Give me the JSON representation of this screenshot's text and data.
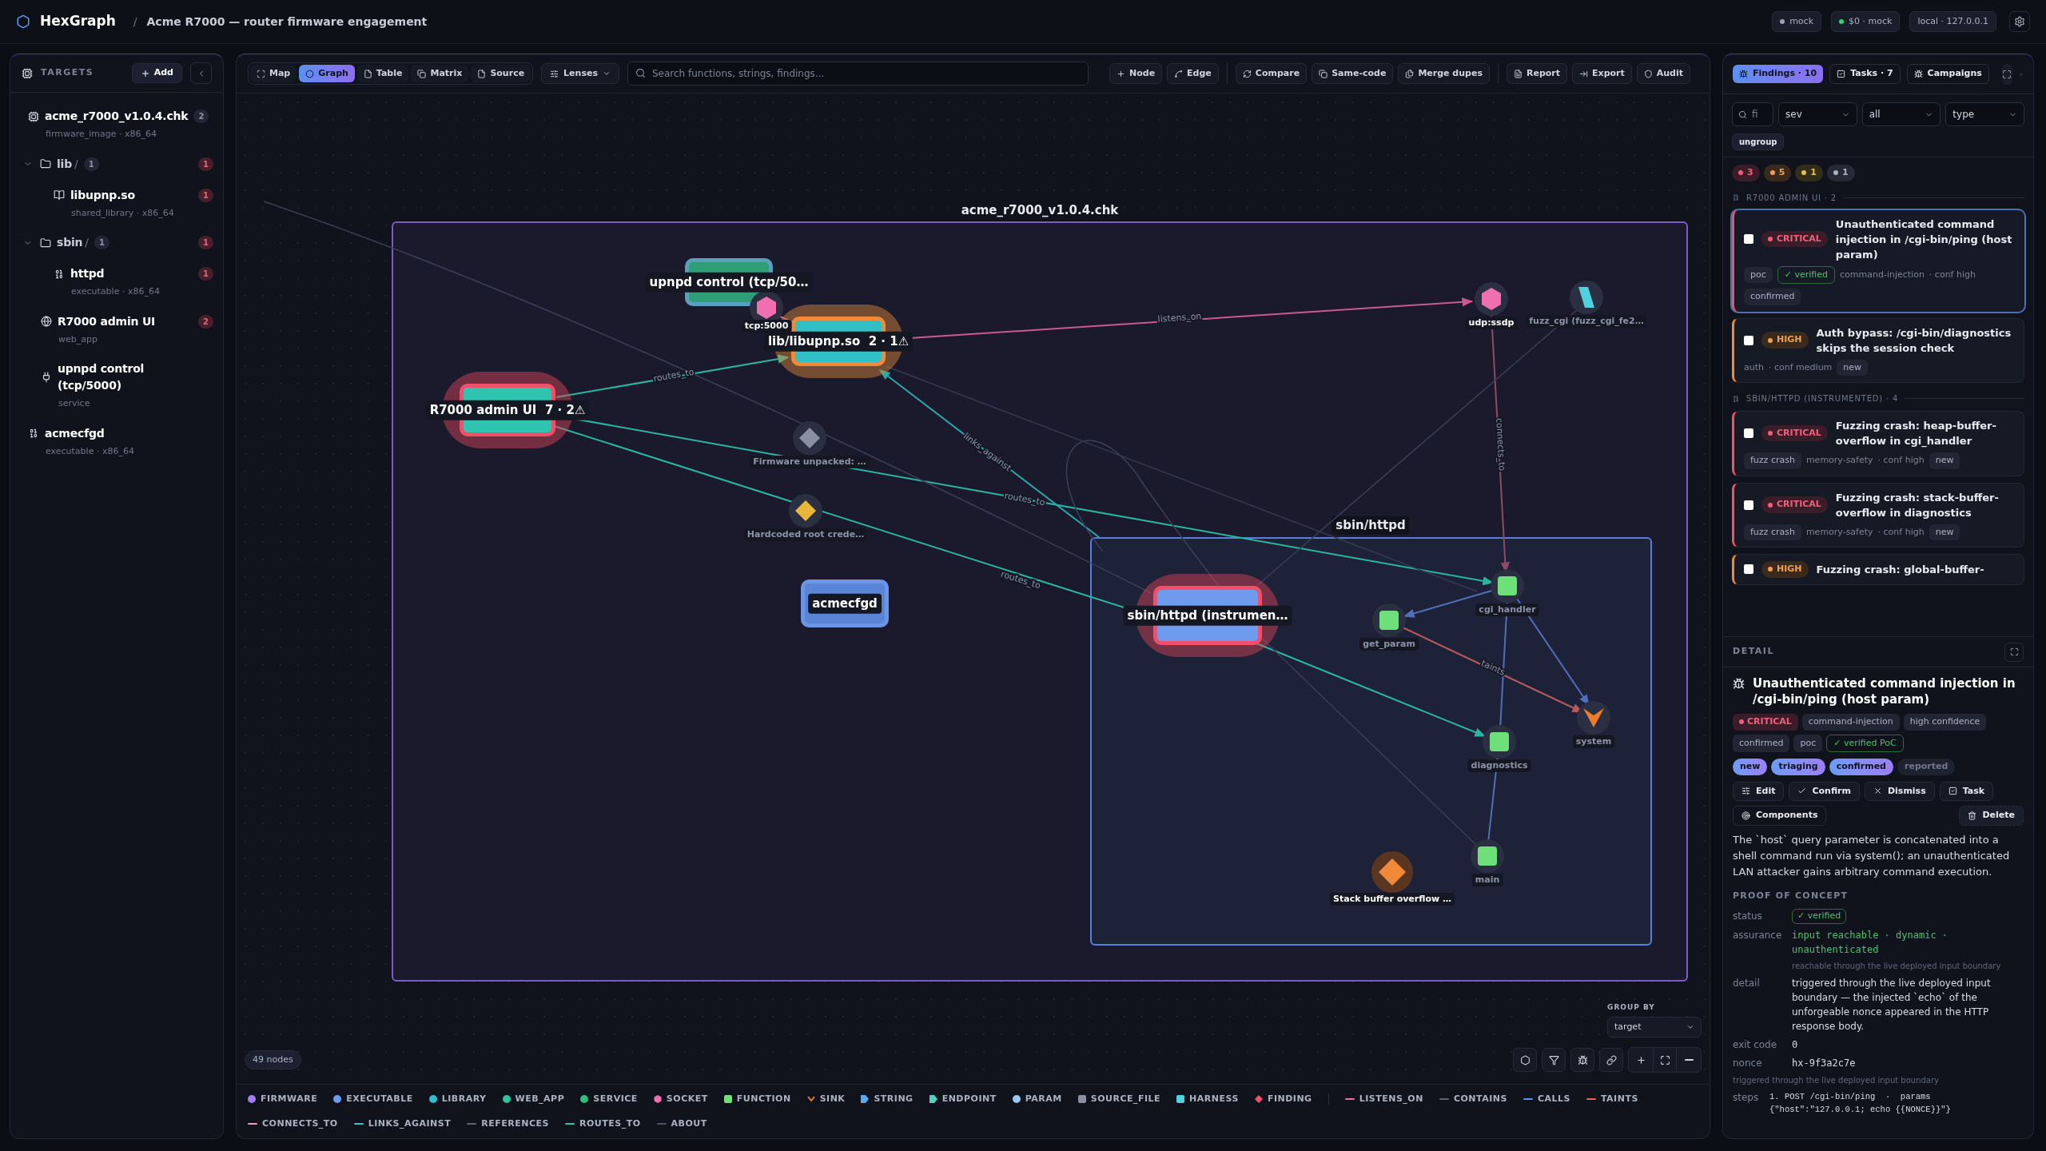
{
  "app": {
    "name": "HexGraph",
    "separator": "/",
    "engagement": "Acme R7000 — router firmware engagement",
    "status_chips": [
      {
        "label": "mock",
        "color": "#9aa3b5"
      },
      {
        "label": "$0 · mock",
        "color": "#3ecf6e"
      },
      {
        "label": "local · 127.0.0.1"
      }
    ]
  },
  "sidebar": {
    "title": "TARGETS",
    "add_button": "Add",
    "targets": [
      {
        "kind": "firmware",
        "name": "acme_r7000_v1.0.4.chk",
        "count": "2",
        "sub": "firmware_image · x86_64",
        "children": [
          {
            "kind": "folder",
            "name": "lib",
            "suffix": "/",
            "count": "1",
            "findings": "1",
            "expanded": true,
            "children": [
              {
                "kind": "library",
                "name": "libupnp.so",
                "sub": "shared_library · x86_64",
                "findings": "1"
              }
            ]
          },
          {
            "kind": "folder",
            "name": "sbin",
            "suffix": "/",
            "count": "1",
            "findings": "1",
            "expanded": true,
            "children": [
              {
                "kind": "executable",
                "name": "httpd",
                "sub": "executable · x86_64",
                "findings": "1"
              }
            ]
          },
          {
            "kind": "web",
            "name": "R7000 admin UI",
            "sub": "web_app",
            "findings": "2"
          },
          {
            "kind": "service",
            "name": "upnpd control (tcp/5000)",
            "sub": "service"
          }
        ]
      },
      {
        "kind": "executable",
        "name": "acmecfgd",
        "sub": "executable · x86_64"
      }
    ]
  },
  "toolbar": {
    "views": [
      {
        "label": "Map",
        "selected": false
      },
      {
        "label": "Graph",
        "selected": true
      },
      {
        "label": "Table",
        "selected": false
      },
      {
        "label": "Matrix",
        "selected": false
      },
      {
        "label": "Source",
        "selected": false
      }
    ],
    "lenses": "Lenses",
    "search_placeholder": "Search functions, strings, findings...",
    "action_groups": [
      [
        "Node",
        "Edge"
      ],
      [
        "Compare",
        "Same-code",
        "Merge dupes"
      ],
      [
        "Report",
        "Export",
        "Audit"
      ]
    ]
  },
  "graph": {
    "groups": [
      {
        "label": "acme_r7000_v1.0.4.chk"
      },
      {
        "label": "sbin/httpd"
      }
    ],
    "nodes": [
      {
        "kind": "box",
        "label": "upnpd control (tcp/50…",
        "color": "#2f9e76",
        "highlighted": true
      },
      {
        "kind": "hexagon",
        "label": "tcp:5000",
        "color": "#f06fb0",
        "highlighted": true
      },
      {
        "kind": "box_high",
        "label": "lib/libupnp.so  2 · 1⚠",
        "color": "#2fbfc4",
        "highlighted": true
      },
      {
        "kind": "hexagon",
        "label": "udp:ssdp",
        "color": "#f06fb0",
        "highlighted": true
      },
      {
        "kind": "parallelogram",
        "label": "fuzz_cgi (fuzz_cgi_fe2…",
        "color": "#4fd1e0",
        "highlighted": false
      },
      {
        "kind": "box_critical",
        "label": "R7000 admin UI  7 · 2⚠",
        "color": "#2ec4b0",
        "highlighted": true
      },
      {
        "kind": "diamond",
        "label": "Firmware unpacked: …",
        "color": "#8a8fa3",
        "highlighted": false
      },
      {
        "kind": "diamond",
        "label": "Hardcoded root crede…",
        "color": "#e8b73a",
        "highlighted": false
      },
      {
        "kind": "box",
        "label": "acmecfgd",
        "color": "#5a85d6",
        "highlighted": true
      },
      {
        "kind": "box_critical",
        "label": "sbin/httpd (instrumen…",
        "color": "#6f9bef",
        "highlighted": true
      },
      {
        "kind": "square",
        "label": "get_param",
        "color": "#6ee07a",
        "highlighted": false
      },
      {
        "kind": "square",
        "label": "cgi_handler",
        "color": "#6ee07a",
        "highlighted": false
      },
      {
        "kind": "square",
        "label": "diagnostics",
        "color": "#6ee07a",
        "highlighted": false
      },
      {
        "kind": "sink",
        "label": "system",
        "color": "#f07b2a",
        "highlighted": false
      },
      {
        "kind": "square",
        "label": "main",
        "color": "#6ee07a",
        "highlighted": false
      },
      {
        "kind": "finding",
        "label": "Stack buffer overflow …",
        "color": "#f08a3a",
        "highlighted": true
      }
    ],
    "edges": [
      {
        "kind": "routes_to",
        "label": "routes_to"
      },
      {
        "kind": "routes_to",
        "label": "routes_to"
      },
      {
        "kind": "routes_to",
        "label": "routes_to"
      },
      {
        "kind": "links_against",
        "label": "links_against"
      },
      {
        "kind": "listens_on",
        "label": "listens_on"
      },
      {
        "kind": "listens_on"
      },
      {
        "kind": "connects_to",
        "label": "connects_to"
      },
      {
        "kind": "routes_to"
      },
      {
        "kind": "calls"
      },
      {
        "kind": "calls"
      },
      {
        "kind": "calls"
      },
      {
        "kind": "taints",
        "label": "taints"
      },
      {
        "kind": "calls"
      },
      {
        "kind": "references"
      },
      {
        "kind": "references"
      },
      {
        "kind": "references"
      },
      {
        "kind": "references"
      },
      {
        "kind": "contains"
      }
    ],
    "node_count": "49 nodes",
    "group_by": {
      "label": "GROUP BY",
      "value": "target"
    }
  },
  "legend": {
    "node_types": [
      {
        "label": "FIRMWARE",
        "kind": "dot",
        "color": "#a47ef0"
      },
      {
        "label": "EXECUTABLE",
        "kind": "dot",
        "color": "#6f9bef"
      },
      {
        "label": "LIBRARY",
        "kind": "dot",
        "color": "#2fbfd0"
      },
      {
        "label": "WEB_APP",
        "kind": "dot",
        "color": "#2ec4a0"
      },
      {
        "label": "SERVICE",
        "kind": "dot",
        "color": "#2fc07a"
      },
      {
        "label": "SOCKET",
        "kind": "hex",
        "color": "#f06fb0"
      },
      {
        "label": "FUNCTION",
        "kind": "square",
        "color": "#6ee07a"
      },
      {
        "label": "SINK",
        "kind": "sink",
        "color": "#f07b2a"
      },
      {
        "label": "STRING",
        "kind": "tag",
        "color": "#5aa8f0"
      },
      {
        "label": "ENDPOINT",
        "kind": "tag",
        "color": "#4fd1c0"
      },
      {
        "label": "PARAM",
        "kind": "dot",
        "color": "#9cc8f5"
      },
      {
        "label": "SOURCE_FILE",
        "kind": "square",
        "color": "#8a8fa3"
      },
      {
        "label": "HARNESS",
        "kind": "square",
        "color": "#4fd1e0"
      },
      {
        "label": "FINDING",
        "kind": "diamond",
        "color": "#f0506a"
      }
    ],
    "edge_types": [
      {
        "label": "LISTENS_ON",
        "color": "#f06f9b"
      },
      {
        "label": "CONTAINS",
        "color": "#5c6375"
      },
      {
        "label": "CALLS",
        "color": "#5b8ff0"
      },
      {
        "label": "TAINTS",
        "color": "#f0605a"
      },
      {
        "label": "CONNECTS_TO",
        "color": "#f0a0c0"
      },
      {
        "label": "LINKS_AGAINST",
        "color": "#2fc8c8"
      },
      {
        "label": "REFERENCES",
        "color": "#5d6476"
      },
      {
        "label": "ROUTES_TO",
        "color": "#2fc0a8"
      },
      {
        "label": "ABOUT",
        "color": "#4c5366"
      }
    ]
  },
  "findings_panel": {
    "tabs": [
      {
        "label": "Findings · 10",
        "selected": true
      },
      {
        "label": "Tasks · 7",
        "selected": false
      },
      {
        "label": "Campaigns",
        "selected": false
      }
    ],
    "search_placeholder": "fi",
    "selects": [
      "sev",
      "all",
      "type"
    ],
    "ungroup": "ungroup",
    "severity_counts": [
      {
        "kind": "critical",
        "count": "3"
      },
      {
        "kind": "high",
        "count": "5"
      },
      {
        "kind": "medium",
        "count": "1"
      },
      {
        "kind": "low",
        "count": "1"
      }
    ],
    "groups": [
      {
        "title": "R7000 ADMIN UI · 2",
        "findings": [
          {
            "kind": "critical",
            "severity_label": "CRITICAL",
            "title": "Unauthenticated command injection in /cgi-bin/ping (host param)",
            "selected": true,
            "checked": false,
            "meta": [
              {
                "kind": "chip",
                "text": "poc"
              },
              {
                "kind": "verified",
                "text": "✓ verified"
              },
              {
                "kind": "text",
                "text": "command-injection"
              },
              {
                "kind": "text",
                "text": "· conf high"
              },
              {
                "kind": "chip",
                "text": "confirmed"
              }
            ]
          },
          {
            "kind": "high",
            "severity_label": "HIGH",
            "title": "Auth bypass: /cgi-bin/diagnostics skips the session check",
            "selected": false,
            "checked": false,
            "meta": [
              {
                "kind": "text",
                "text": "auth"
              },
              {
                "kind": "text",
                "text": "· conf medium"
              },
              {
                "kind": "chip",
                "text": "new"
              }
            ]
          }
        ]
      },
      {
        "title": "SBIN/HTTPD (INSTRUMENTED) · 4",
        "findings": [
          {
            "kind": "critical",
            "severity_label": "CRITICAL",
            "title": "Fuzzing crash: heap-buffer-overflow in cgi_handler",
            "selected": false,
            "checked": false,
            "meta": [
              {
                "kind": "chip",
                "text": "fuzz crash"
              },
              {
                "kind": "text",
                "text": "memory-safety"
              },
              {
                "kind": "text",
                "text": "· conf high"
              },
              {
                "kind": "chip",
                "text": "new"
              }
            ]
          },
          {
            "kind": "critical",
            "severity_label": "CRITICAL",
            "title": "Fuzzing crash: stack-buffer-overflow in diagnostics",
            "selected": false,
            "checked": false,
            "meta": [
              {
                "kind": "chip",
                "text": "fuzz crash"
              },
              {
                "kind": "text",
                "text": "memory-safety"
              },
              {
                "kind": "text",
                "text": "· conf high"
              },
              {
                "kind": "chip",
                "text": "new"
              }
            ]
          },
          {
            "kind": "high",
            "severity_label": "HIGH",
            "title": "Fuzzing crash: global-buffer-",
            "selected": false,
            "checked": false
          }
        ]
      }
    ]
  },
  "detail": {
    "heading": "DETAIL",
    "title": "Unauthenticated command injection in /cgi-bin/ping (host param)",
    "tags": [
      {
        "kind": "severity",
        "text": "CRITICAL"
      },
      {
        "kind": "chip",
        "text": "command-injection"
      },
      {
        "kind": "chip",
        "text": "high confidence"
      },
      {
        "kind": "chip",
        "text": "confirmed"
      },
      {
        "kind": "chip",
        "text": "poc"
      },
      {
        "kind": "verified",
        "text": "✓ verified PoC"
      }
    ],
    "workflow": [
      {
        "label": "new",
        "reached": true
      },
      {
        "label": "triaging",
        "reached": true
      },
      {
        "label": "confirmed",
        "reached": true
      },
      {
        "label": "reported",
        "reached": false
      }
    ],
    "actions": [
      "Edit",
      "Confirm",
      "Dismiss",
      "Task"
    ],
    "components": "Components",
    "delete": "Delete",
    "description": "The `host` query parameter is concatenated into a shell command run via system(); an unauthenticated LAN attacker gains arbitrary command execution.",
    "poc_heading": "PROOF OF CONCEPT",
    "poc_rows": [
      {
        "kind": "badge",
        "key": "status",
        "value": "✓ verified"
      },
      {
        "kind": "assurance",
        "key": "assurance",
        "value": "input reachable · dynamic · unauthenticated",
        "note": "reachable through the live deployed input boundary"
      },
      {
        "kind": "text",
        "key": "detail",
        "value": "triggered through the live deployed input boundary — the injected `echo` of the unforgeable nonce appeared in the HTTP response body."
      },
      {
        "kind": "mono",
        "key": "exit code",
        "value": "0"
      },
      {
        "kind": "mono",
        "key": "nonce",
        "value": "hx-9f3a2c7e"
      },
      {
        "kind": "note",
        "value": "triggered through the live deployed input boundary"
      },
      {
        "kind": "steps",
        "key": "steps",
        "value": "1. POST /cgi-bin/ping  ·  params {\"host\":\"127.0.0.1; echo {{NONCE}}\"}"
      }
    ]
  }
}
